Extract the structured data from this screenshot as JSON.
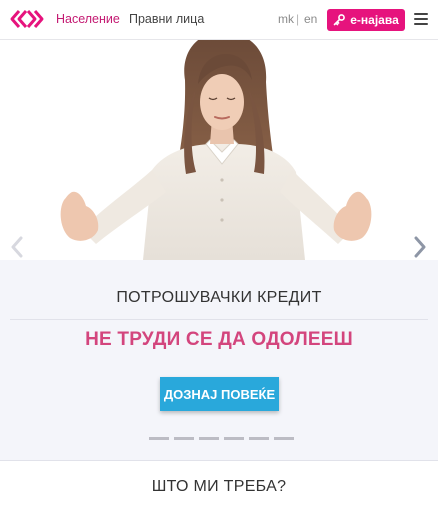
{
  "header": {
    "nav": [
      {
        "label": "Население"
      },
      {
        "label": "Правни лица"
      }
    ],
    "lang": {
      "mk": "mk",
      "separator": "|",
      "en": "en"
    },
    "login_label": "е-најава",
    "brand_color": "#e6137d"
  },
  "hero": {
    "image": "woman-meditating-photo"
  },
  "promo": {
    "kicker": "ПОТРОШУВАЧКИ КРЕДИТ",
    "headline": "НЕ ТРУДИ СЕ ДА ОДОЛЕЕШ",
    "cta_label": "ДОЗНАЈ ПОВЕЌЕ",
    "cta_color": "#29a8db",
    "headline_color": "#d3457d",
    "slide_count": 6
  },
  "section": {
    "title": "ШТО МИ ТРЕБА?"
  }
}
